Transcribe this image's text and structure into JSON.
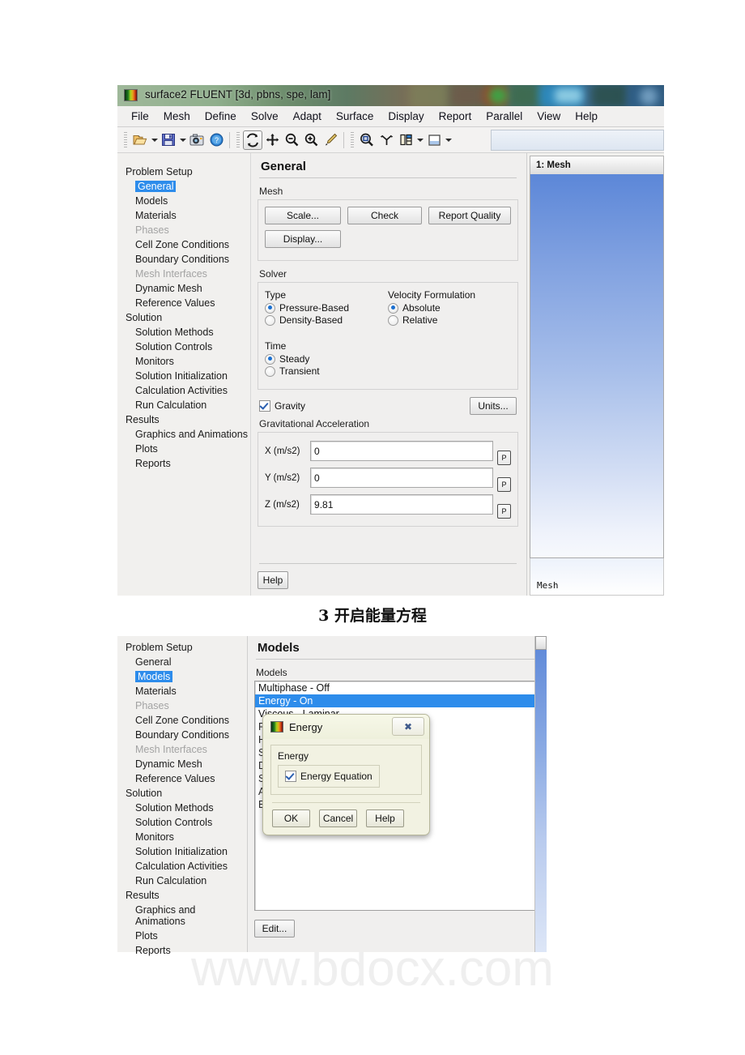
{
  "fig1": {
    "titlebar": {
      "title": "surface2 FLUENT  [3d, pbns, spe, lam]",
      "icon": "fluent-logo-icon"
    },
    "menubar": [
      "File",
      "Mesh",
      "Define",
      "Solve",
      "Adapt",
      "Surface",
      "Display",
      "Report",
      "Parallel",
      "View",
      "Help"
    ],
    "toolbar": {
      "icons": [
        "open-folder-icon",
        "dropdown-caret-icon",
        "save-disk-icon",
        "dropdown-caret-icon",
        "camera-icon",
        "help-circle-icon",
        "rotate-icon",
        "pan-icon",
        "zoom-out-icon",
        "zoom-in-icon",
        "probe-icon",
        "zoom-region-icon",
        "axis-icon",
        "grid-icon",
        "dropdown-caret-icon",
        "viewport-icon",
        "dropdown-caret-icon"
      ]
    },
    "tree": [
      {
        "label": "Problem Setup",
        "type": "group"
      },
      {
        "label": "General",
        "type": "item",
        "state": "selected"
      },
      {
        "label": "Models",
        "type": "item"
      },
      {
        "label": "Materials",
        "type": "item"
      },
      {
        "label": "Phases",
        "type": "item",
        "state": "disabled"
      },
      {
        "label": "Cell Zone Conditions",
        "type": "item"
      },
      {
        "label": "Boundary Conditions",
        "type": "item"
      },
      {
        "label": "Mesh Interfaces",
        "type": "item",
        "state": "disabled"
      },
      {
        "label": "Dynamic Mesh",
        "type": "item"
      },
      {
        "label": "Reference Values",
        "type": "item"
      },
      {
        "label": "Solution",
        "type": "group"
      },
      {
        "label": "Solution Methods",
        "type": "item"
      },
      {
        "label": "Solution Controls",
        "type": "item"
      },
      {
        "label": "Monitors",
        "type": "item"
      },
      {
        "label": "Solution Initialization",
        "type": "item"
      },
      {
        "label": "Calculation Activities",
        "type": "item"
      },
      {
        "label": "Run Calculation",
        "type": "item"
      },
      {
        "label": "Results",
        "type": "group"
      },
      {
        "label": "Graphics and Animations",
        "type": "item"
      },
      {
        "label": "Plots",
        "type": "item"
      },
      {
        "label": "Reports",
        "type": "item"
      }
    ],
    "panel": {
      "title": "General",
      "mesh_label": "Mesh",
      "mesh_buttons": [
        "Scale...",
        "Check",
        "Report Quality",
        "Display..."
      ],
      "solver_label": "Solver",
      "type_label": "Type",
      "type_options": [
        "Pressure-Based",
        "Density-Based"
      ],
      "type_selected": "Pressure-Based",
      "velocity_label": "Velocity Formulation",
      "velocity_options": [
        "Absolute",
        "Relative"
      ],
      "velocity_selected": "Absolute",
      "time_label": "Time",
      "time_options": [
        "Steady",
        "Transient"
      ],
      "time_selected": "Steady",
      "gravity_label": "Gravity",
      "gravity_checked": true,
      "units_button": "Units...",
      "grav_accel_label": "Gravitational Acceleration",
      "grav_fields": [
        {
          "label": "X (m/s2)",
          "value": "0",
          "unit_button": "P"
        },
        {
          "label": "Y (m/s2)",
          "value": "0",
          "unit_button": "P"
        },
        {
          "label": "Z (m/s2)",
          "value": "9.81",
          "unit_button": "P"
        }
      ],
      "help_button": "Help"
    },
    "graphics": {
      "tab": "1: Mesh",
      "status": "Mesh"
    }
  },
  "caption": "3 开启能量方程",
  "fig2": {
    "tree": [
      {
        "label": "Problem Setup",
        "type": "group"
      },
      {
        "label": "General",
        "type": "item"
      },
      {
        "label": "Models",
        "type": "item",
        "state": "selected"
      },
      {
        "label": "Materials",
        "type": "item"
      },
      {
        "label": "Phases",
        "type": "item",
        "state": "disabled"
      },
      {
        "label": "Cell Zone Conditions",
        "type": "item"
      },
      {
        "label": "Boundary Conditions",
        "type": "item"
      },
      {
        "label": "Mesh Interfaces",
        "type": "item",
        "state": "disabled"
      },
      {
        "label": "Dynamic Mesh",
        "type": "item"
      },
      {
        "label": "Reference Values",
        "type": "item"
      },
      {
        "label": "Solution",
        "type": "group"
      },
      {
        "label": "Solution Methods",
        "type": "item"
      },
      {
        "label": "Solution Controls",
        "type": "item"
      },
      {
        "label": "Monitors",
        "type": "item"
      },
      {
        "label": "Solution Initialization",
        "type": "item"
      },
      {
        "label": "Calculation Activities",
        "type": "item"
      },
      {
        "label": "Run Calculation",
        "type": "item"
      },
      {
        "label": "Results",
        "type": "group"
      },
      {
        "label": "Graphics and Animations",
        "type": "item"
      },
      {
        "label": "Plots",
        "type": "item"
      },
      {
        "label": "Reports",
        "type": "item"
      }
    ],
    "panel": {
      "title": "Models",
      "list_label": "Models",
      "items": [
        {
          "label": "Multiphase - Off",
          "selected": false
        },
        {
          "label": "Energy - On",
          "selected": true
        },
        {
          "label": "Viscous - Laminar",
          "selected": false
        },
        {
          "label": "Radiation - Off",
          "selected": false
        },
        {
          "label": "Heat Exchanger - Off",
          "selected": false
        },
        {
          "label": "Species - Off",
          "selected": false
        },
        {
          "label": "Discrete Phase - Off",
          "selected": false
        },
        {
          "label": "Solidification & Melting - Off",
          "selected": false
        },
        {
          "label": "Acoustics - Off",
          "selected": false
        },
        {
          "label": "Eulerian Wall Film - Off",
          "selected": false
        }
      ],
      "edit_button": "Edit..."
    },
    "dialog": {
      "title": "Energy",
      "icon": "fluent-logo-icon",
      "close_glyph": "✖",
      "group_label": "Energy",
      "checkbox_label": "Energy Equation",
      "checkbox_checked": true,
      "buttons": [
        "OK",
        "Cancel",
        "Help"
      ]
    }
  },
  "watermark": {
    "text": "www.bdocx.com",
    "color": "#e2e2e2"
  }
}
